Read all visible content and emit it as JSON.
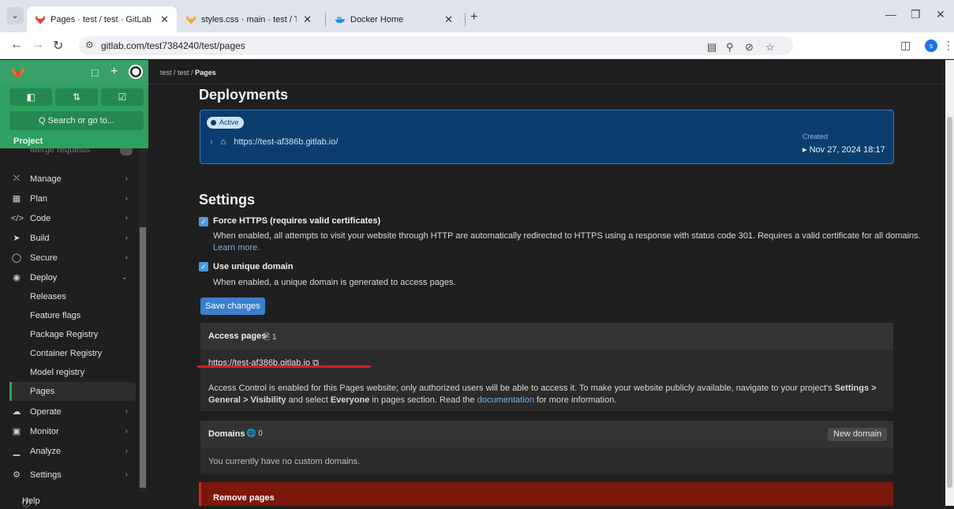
{
  "browser": {
    "tabs": [
      {
        "title": "Pages · test / test · GitLab"
      },
      {
        "title": "styles.css · main · test / Testing"
      },
      {
        "title": "Docker Home"
      }
    ],
    "url": "gitlab.com/test7384240/test/pages",
    "profile_initial": "s"
  },
  "sidebar": {
    "search_label": "Q  Search or go to...",
    "project_label": "Project",
    "cut_item": "Merge requests",
    "items": [
      {
        "label": "Manage",
        "icon": "briefcase-icon"
      },
      {
        "label": "Plan",
        "icon": "calendar-icon"
      },
      {
        "label": "Code",
        "icon": "code-icon"
      },
      {
        "label": "Build",
        "icon": "rocket-icon"
      },
      {
        "label": "Secure",
        "icon": "shield-icon"
      },
      {
        "label": "Deploy",
        "icon": "deploy-icon"
      }
    ],
    "deploy_sub": [
      "Releases",
      "Feature flags",
      "Package Registry",
      "Container Registry",
      "Model registry",
      "Pages"
    ],
    "items2": [
      {
        "label": "Operate",
        "icon": "cloud-icon"
      },
      {
        "label": "Monitor",
        "icon": "monitor-icon"
      },
      {
        "label": "Analyze",
        "icon": "chart-icon"
      },
      {
        "label": "Settings",
        "icon": "gear-icon"
      }
    ],
    "help": "Help"
  },
  "breadcrumb": {
    "b1": "test",
    "b2": "test",
    "current": "Pages"
  },
  "deployments": {
    "heading": "Deployments",
    "badge": "Active",
    "url": "https://test-af386b.gitlab.io/",
    "created_label": "Created",
    "created_date": "Nov 27, 2024 18:17"
  },
  "settings": {
    "heading": "Settings",
    "force_https": {
      "label": "Force HTTPS (requires valid certificates)",
      "help": "When enabled, all attempts to visit your website through HTTP are automatically redirected to HTTPS using a response with status code 301. Requires a valid certificate for all domains.",
      "learn_more": "Learn more."
    },
    "unique_domain": {
      "label": "Use unique domain",
      "help": "When enabled, a unique domain is generated to access pages."
    },
    "save_button": "Save changes"
  },
  "access_pages": {
    "title": "Access pages",
    "count": "1",
    "url": "https://test-af386b.gitlab.io",
    "notice_1": "Access Control is enabled for this Pages website; only authorized users will be able to access it. To make your website publicly available, navigate to your project's ",
    "notice_bold_1": "Settings > General > Visibility",
    "notice_2": " and select ",
    "notice_bold_2": "Everyone",
    "notice_3": " in pages section. Read the ",
    "notice_link": "documentation",
    "notice_4": " for more information."
  },
  "domains": {
    "title": "Domains",
    "count": "0",
    "new_button": "New domain",
    "empty": "You currently have no custom domains."
  },
  "remove_pages": {
    "title": "Remove pages"
  },
  "colors": {
    "sidebar_accent": "#2da160",
    "deploy_card": "#0b3e6e",
    "danger": "#7c170c"
  }
}
